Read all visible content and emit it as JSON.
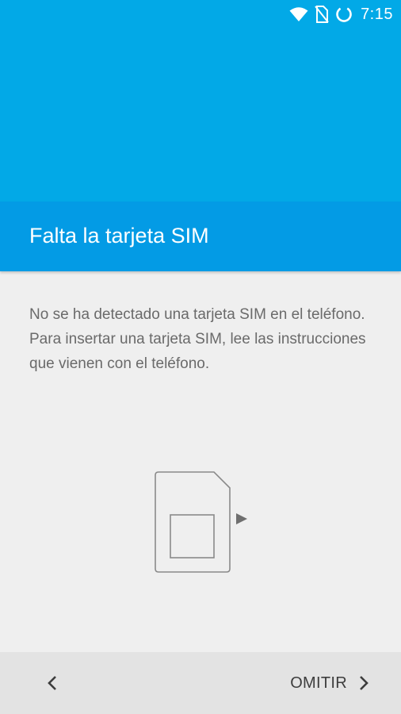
{
  "status_bar": {
    "time": "7:15",
    "icons": [
      "wifi-icon",
      "no-sim-icon",
      "battery-charging-icon"
    ]
  },
  "header": {
    "title": "Falta la tarjeta SIM"
  },
  "main": {
    "description": "No se ha detectado una tarjeta SIM en el teléfono. Para insertar una tarjeta SIM, lee las instrucciones que vienen con el teléfono.",
    "illustration": "sim-card-insert-icon"
  },
  "footer": {
    "back_icon": "chevron-left-icon",
    "skip_label": "OMITIR",
    "skip_icon": "chevron-right-icon"
  },
  "colors": {
    "top_area": "#02a9e7",
    "title_bar": "#039be5",
    "background": "#efefef",
    "bottom_bar": "#e3e3e3",
    "text_secondary": "#6a6a6a"
  }
}
